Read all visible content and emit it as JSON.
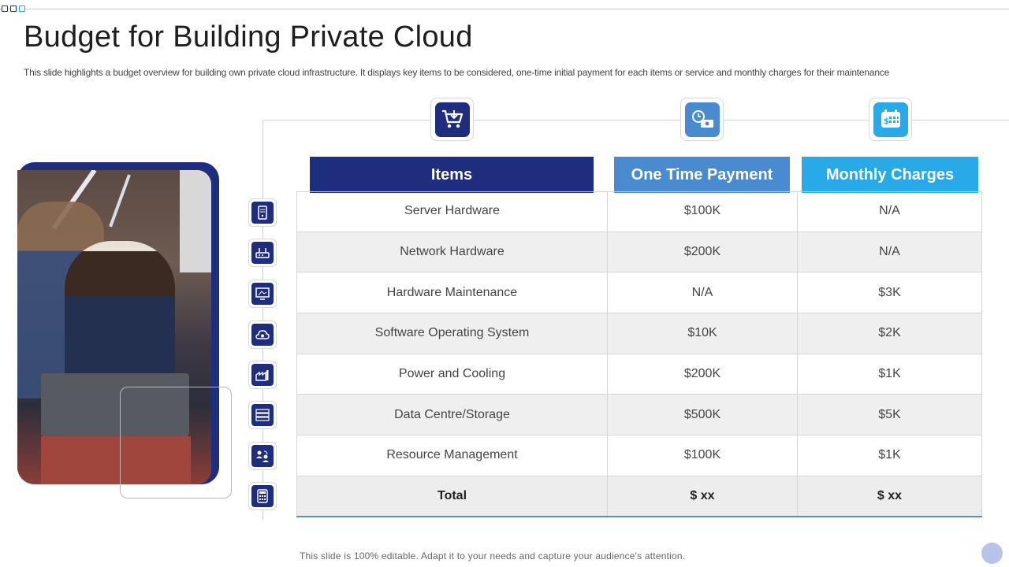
{
  "slide": {
    "title": "Budget for Building Private Cloud",
    "subtitle": "This slide highlights a budget overview for building own private cloud infrastructure. It displays key items to be considered, one-time initial payment for each items or service and monthly charges for their maintenance",
    "footer": "This slide is 100% editable. Adapt it to your needs and capture your audience's attention."
  },
  "colors": {
    "navy": "#1f2d7e",
    "mid_blue": "#4a8bd0",
    "light_blue": "#2aa9e8"
  },
  "header_icons": [
    "shopping-cart-icon",
    "clock-cash-icon",
    "calendar-money-icon"
  ],
  "table": {
    "headers": [
      "Items",
      "One Time Payment",
      "Monthly Charges"
    ],
    "rows": [
      {
        "icon": "server-icon",
        "item": "Server Hardware",
        "one_time": "$100K",
        "monthly": "N/A"
      },
      {
        "icon": "router-icon",
        "item": "Network Hardware",
        "one_time": "$200K",
        "monthly": "N/A"
      },
      {
        "icon": "monitor-icon",
        "item": "Hardware Maintenance",
        "one_time": "N/A",
        "monthly": "$3K"
      },
      {
        "icon": "cloud-gear-icon",
        "item": "Software Operating System",
        "one_time": "$10K",
        "monthly": "$2K"
      },
      {
        "icon": "power-plant-icon",
        "item": "Power and Cooling",
        "one_time": "$200K",
        "monthly": "$1K"
      },
      {
        "icon": "storage-icon",
        "item": "Data Centre/Storage",
        "one_time": "$500K",
        "monthly": "$5K"
      },
      {
        "icon": "people-management-icon",
        "item": "Resource Management",
        "one_time": "$100K",
        "monthly": "$1K"
      },
      {
        "icon": "calculator-icon",
        "item": "Total",
        "one_time": "$ xx",
        "monthly": "$ xx"
      }
    ]
  }
}
